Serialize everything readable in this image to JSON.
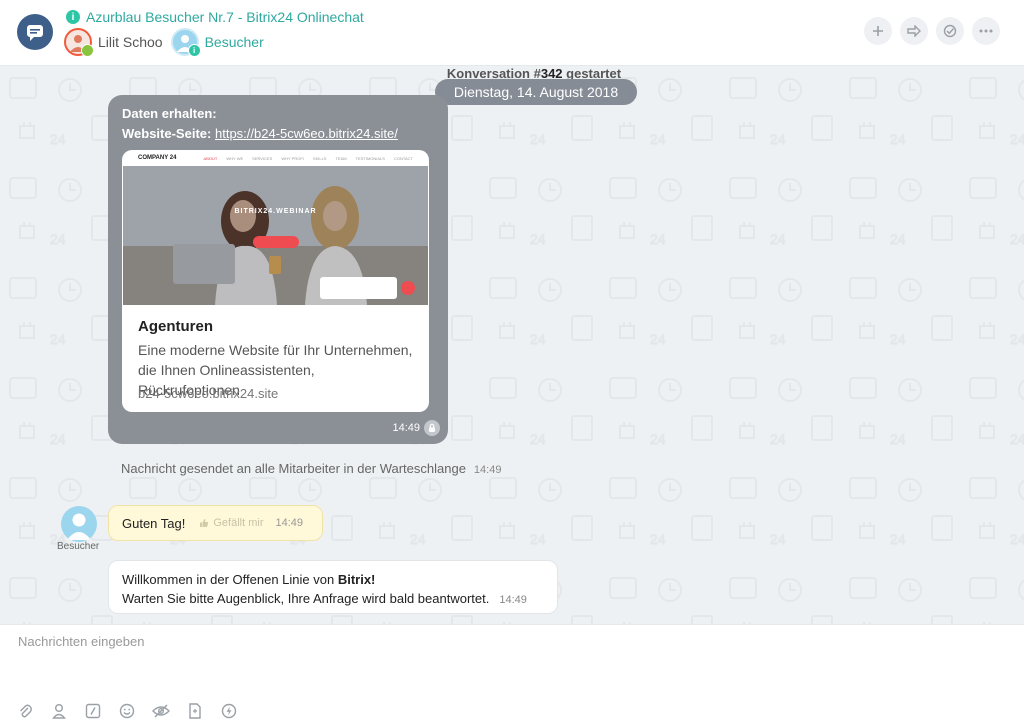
{
  "header": {
    "title": "Azurblau Besucher Nr.7 - Bitrix24 Onlinechat",
    "members": [
      {
        "name": "Lilit Schoo"
      },
      {
        "name": "Besucher"
      }
    ]
  },
  "chat": {
    "conversation_prefix": "Konversation #",
    "conversation_number": "342",
    "conversation_suffix": " gestartet",
    "date": "Dienstag, 14. August 2018",
    "system_message": {
      "line1": "Daten erhalten:",
      "line2_label": "Website-Seite",
      "line2_sep": ":",
      "url": "https://b24-5cw6eo.bitrix24.site/",
      "card": {
        "nav_brand": "COMPANY 24",
        "nav_items": [
          "ABOUT",
          "WHY WE",
          "SERVICES",
          "WHY PROFI",
          "SKILLS",
          "TEAM",
          "TESTIMONIALS",
          "CONTACT"
        ],
        "image_title": "BITRIX24.WEBINAR",
        "title": "Agenturen",
        "description": "Eine moderne Website für Ihr Unternehmen, die Ihnen Onlineassistenten, Rückrufoptionen",
        "domain": "b24-5cw6eo.bitrix24.site"
      },
      "time": "14:49"
    },
    "notice": {
      "text": "Nachricht gesendet an alle Mitarbeiter in der Warteschlange",
      "time": "14:49"
    },
    "guest_message": {
      "author": "Besucher",
      "text": "Guten Tag!",
      "like_label": "Gefällt mir",
      "time": "14:49"
    },
    "operator_message": {
      "line1_prefix": "Willkommen in der Offenen Linie von ",
      "line1_bold": "Bitrix!",
      "line2": "Warten Sie bitte Augenblick, Ihre Anfrage wird bald beantwortet.",
      "time": "14:49"
    }
  },
  "input": {
    "placeholder": "Nachrichten eingeben",
    "tools": [
      "paperclip-icon",
      "user-icon",
      "slash-icon",
      "smile-icon",
      "eye-off-icon",
      "document-icon",
      "lightning-icon"
    ]
  },
  "colors": {
    "accent": "#2fa9a0",
    "logo": "#3e5f8a",
    "system_bubble": "#8b9097",
    "guest_bubble": "#fff8d9"
  }
}
